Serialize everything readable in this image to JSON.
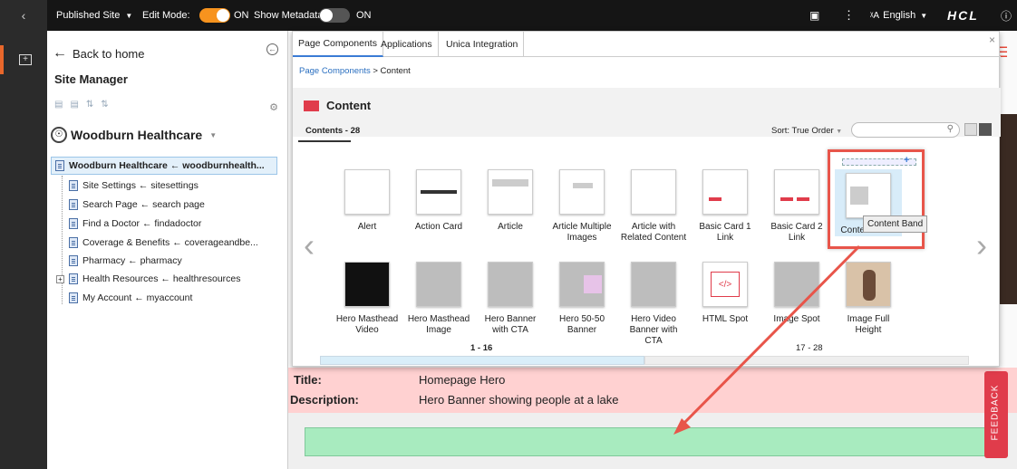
{
  "topbar": {
    "back_icon": "chevron-left-icon",
    "site_label": "Published Site",
    "edit_mode_label": "Edit Mode:",
    "edit_mode_state": "ON",
    "show_metadata_label": "Show Metadata:",
    "show_metadata_state": "ON",
    "language": "English",
    "brand": "HCL",
    "colors": {
      "accent": "#f7931e",
      "bar": "#151515"
    }
  },
  "sidebar": {
    "back_label": "Back to home",
    "title": "Site Manager",
    "site_name": "Woodburn Healthcare",
    "tree": [
      {
        "label": "Woodburn Healthcare",
        "slug": "woodburnhealth..."
      },
      {
        "label": "Site Settings",
        "slug": "sitesettings"
      },
      {
        "label": "Search Page",
        "slug": "search page"
      },
      {
        "label": "Find a Doctor",
        "slug": "findadoctor"
      },
      {
        "label": "Coverage & Benefits",
        "slug": "coverageandbe..."
      },
      {
        "label": "Pharmacy",
        "slug": "pharmacy"
      },
      {
        "label": "Health Resources",
        "slug": "healthresources"
      },
      {
        "label": "My Account",
        "slug": "myaccount"
      }
    ],
    "arrow": "←"
  },
  "modal": {
    "tabs": [
      "Page Components",
      "Applications",
      "Unica Integration"
    ],
    "breadcrumb_link": "Page Components",
    "breadcrumb_sep": ">",
    "breadcrumb_current": "Content",
    "heading": "Content",
    "contents_count": "Contents - 28",
    "sort_label": "Sort:",
    "sort_value": "True Order",
    "search_placeholder": "",
    "cards_row1": [
      "Alert",
      "Action Card",
      "Article",
      "Article Multiple Images",
      "Article with Related Content",
      "Basic Card 1 Link",
      "Basic Card 2 Link",
      "Content Band"
    ],
    "cards_row2": [
      "Hero Masthead Video",
      "Hero Masthead Image",
      "Hero Banner with CTA",
      "Hero 50-50 Banner",
      "Hero Video Banner with CTA",
      "HTML Spot",
      "Image Spot",
      "Image Full Height"
    ],
    "tooltip": "Content Band",
    "page_range_1": "1 - 16",
    "page_range_2": "17 - 28"
  },
  "page_background": {
    "title_label": "Title:",
    "title_value": "Homepage Hero",
    "description_label": "Description:",
    "description_value": "Hero Banner showing people at a lake",
    "feedback": "FEEDBACK"
  }
}
